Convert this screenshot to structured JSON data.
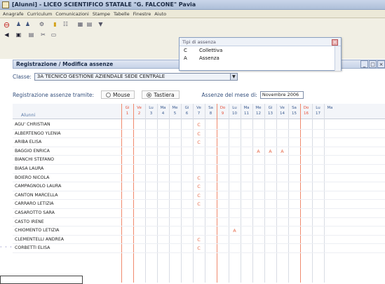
{
  "window": {
    "title": "[Alunni] - LICEO SCIENTIFICO STATALE \"G. FALCONE\" Pavia"
  },
  "menu": [
    "Anagrafe",
    "Curriculum",
    "Comunicazioni",
    "Stampe",
    "Tabelle",
    "Finestre",
    "Aiuto"
  ],
  "subwindow": {
    "title": "Registrazione / Modifica assenze"
  },
  "popup": {
    "header": "Tipi di assenza",
    "rows": [
      {
        "code": "C",
        "label": "Collettiva"
      },
      {
        "code": "A",
        "label": "Assenza"
      }
    ]
  },
  "classe": {
    "label": "Classe:",
    "value": "3A TECNICO GESTIONE AZIENDALE SEDE CENTRALE"
  },
  "registrazione": {
    "label": "Registrazione assenze tramite:",
    "options": [
      "Mouse",
      "Tastiera"
    ],
    "selected": "Tastiera",
    "month_label": "Assenze del mese di:",
    "month_value": "Novembre 2006"
  },
  "grid": {
    "students_header": "Alunni",
    "days": [
      {
        "wd": "Gi",
        "n": "1",
        "red": true
      },
      {
        "wd": "Ve",
        "n": "2",
        "red": true
      },
      {
        "wd": "Lu",
        "n": "3",
        "red": false
      },
      {
        "wd": "Ma",
        "n": "4",
        "red": false
      },
      {
        "wd": "Me",
        "n": "5",
        "red": false
      },
      {
        "wd": "Gi",
        "n": "6",
        "red": false
      },
      {
        "wd": "Ve",
        "n": "7",
        "red": false
      },
      {
        "wd": "Sa",
        "n": "8",
        "red": false
      },
      {
        "wd": "Do",
        "n": "9",
        "red": true
      },
      {
        "wd": "Lu",
        "n": "10",
        "red": false
      },
      {
        "wd": "Ma",
        "n": "11",
        "red": false
      },
      {
        "wd": "Me",
        "n": "12",
        "red": false
      },
      {
        "wd": "Gi",
        "n": "13",
        "red": false
      },
      {
        "wd": "Ve",
        "n": "14",
        "red": false
      },
      {
        "wd": "Sa",
        "n": "15",
        "red": false
      },
      {
        "wd": "Do",
        "n": "16",
        "red": true
      },
      {
        "wd": "Lu",
        "n": "17",
        "red": false
      },
      {
        "wd": "Ma",
        "n": "",
        "red": false
      }
    ],
    "students": [
      {
        "name": "AGU' CHRISTIAN",
        "marks": {
          "7": "C"
        }
      },
      {
        "name": "ALBERTENGO YLENIA",
        "marks": {
          "7": "C"
        }
      },
      {
        "name": "ARIBA ELISA",
        "marks": {
          "7": "C"
        }
      },
      {
        "name": "BAGGIO ENRICA",
        "marks": {
          "12": "A",
          "13": "A",
          "14": "A"
        }
      },
      {
        "name": "BIANCHI STEFANO",
        "marks": {}
      },
      {
        "name": "BIASA LAURA",
        "marks": {}
      },
      {
        "name": "BOIERO NICOLA",
        "marks": {
          "7": "C"
        }
      },
      {
        "name": "CAMPAGNOLO LAURA",
        "marks": {
          "7": "C"
        }
      },
      {
        "name": "CANTON MARCELLA",
        "marks": {
          "7": "C"
        }
      },
      {
        "name": "CARRARO LETIZIA",
        "marks": {
          "7": "C"
        }
      },
      {
        "name": "CASAROTTO SARA",
        "marks": {}
      },
      {
        "name": "CASTO IRENE",
        "marks": {}
      },
      {
        "name": "CHIOMENTO LETIZIA",
        "marks": {
          "10": "A"
        }
      },
      {
        "name": "CLEMENTELLI ANDREA",
        "marks": {
          "7": "C"
        }
      },
      {
        "name": "CORBETTI ELISA",
        "marks": {
          "7": "C"
        }
      }
    ]
  }
}
